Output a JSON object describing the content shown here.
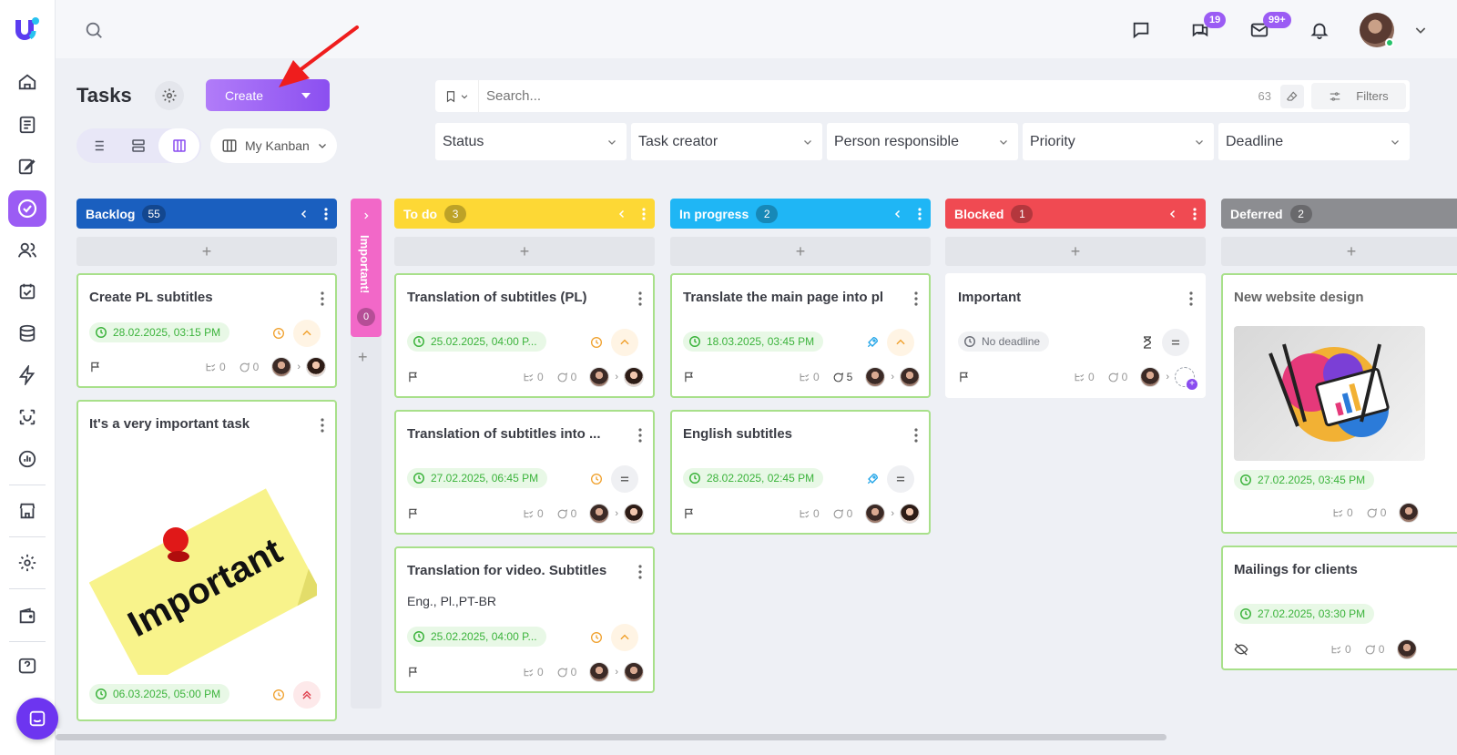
{
  "app": {
    "brand_color": "#9b5cf4"
  },
  "topbar": {
    "messages_badge": "19",
    "mail_badge": "99+"
  },
  "header": {
    "title": "Tasks",
    "create_label": "Create",
    "view_select": "My Kanban"
  },
  "search": {
    "placeholder": "Search...",
    "count": "63",
    "filters_label": "Filters"
  },
  "filters": [
    "Status",
    "Task creator",
    "Person responsible",
    "Priority",
    "Deadline"
  ],
  "columns": [
    {
      "name": "Backlog",
      "count": "55",
      "color": "#1a5fbf",
      "cards": [
        {
          "title": "Create PL subtitles",
          "date": "28.02.2025, 03:15 PM",
          "subtasks": "0",
          "comments": "0"
        },
        {
          "title": "It's a very important task",
          "image_text": "Important",
          "date": "06.03.2025, 05:00 PM"
        }
      ]
    },
    {
      "name": "Important!",
      "count": "0",
      "color": "#f268c8",
      "collapsed": true
    },
    {
      "name": "To do",
      "count": "3",
      "color": "#fdd835",
      "cards": [
        {
          "title": "Translation of subtitles (PL)",
          "date": "25.02.2025, 04:00 P...",
          "subtasks": "0",
          "comments": "0"
        },
        {
          "title": "Translation of subtitles into ...",
          "date": "27.02.2025, 06:45 PM",
          "subtasks": "0",
          "comments": "0"
        },
        {
          "title": "Translation for video. Subtitles",
          "description": "Eng., Pl.,PT-BR",
          "date": "25.02.2025, 04:00 P...",
          "subtasks": "0",
          "comments": "0"
        }
      ]
    },
    {
      "name": "In progress",
      "count": "2",
      "color": "#1fb6f5",
      "cards": [
        {
          "title": "Translate the main page into pl",
          "date": "18.03.2025, 03:45 PM",
          "subtasks": "0",
          "comments": "5"
        },
        {
          "title": "English subtitles",
          "date": "28.02.2025, 02:45 PM",
          "subtasks": "0",
          "comments": "0"
        }
      ]
    },
    {
      "name": "Blocked",
      "count": "1",
      "color": "#f04a52",
      "cards": [
        {
          "title": "Important",
          "date": "No deadline",
          "subtasks": "0",
          "comments": "0"
        }
      ]
    },
    {
      "name": "Deferred",
      "count": "2",
      "color": "#8c8d91",
      "cards": [
        {
          "title": "New website design",
          "date": "27.02.2025, 03:45 PM",
          "subtasks": "0",
          "comments": "0"
        },
        {
          "title": "Mailings for clients",
          "date": "27.02.2025, 03:30 PM",
          "subtasks": "0",
          "comments": "0"
        }
      ]
    }
  ]
}
